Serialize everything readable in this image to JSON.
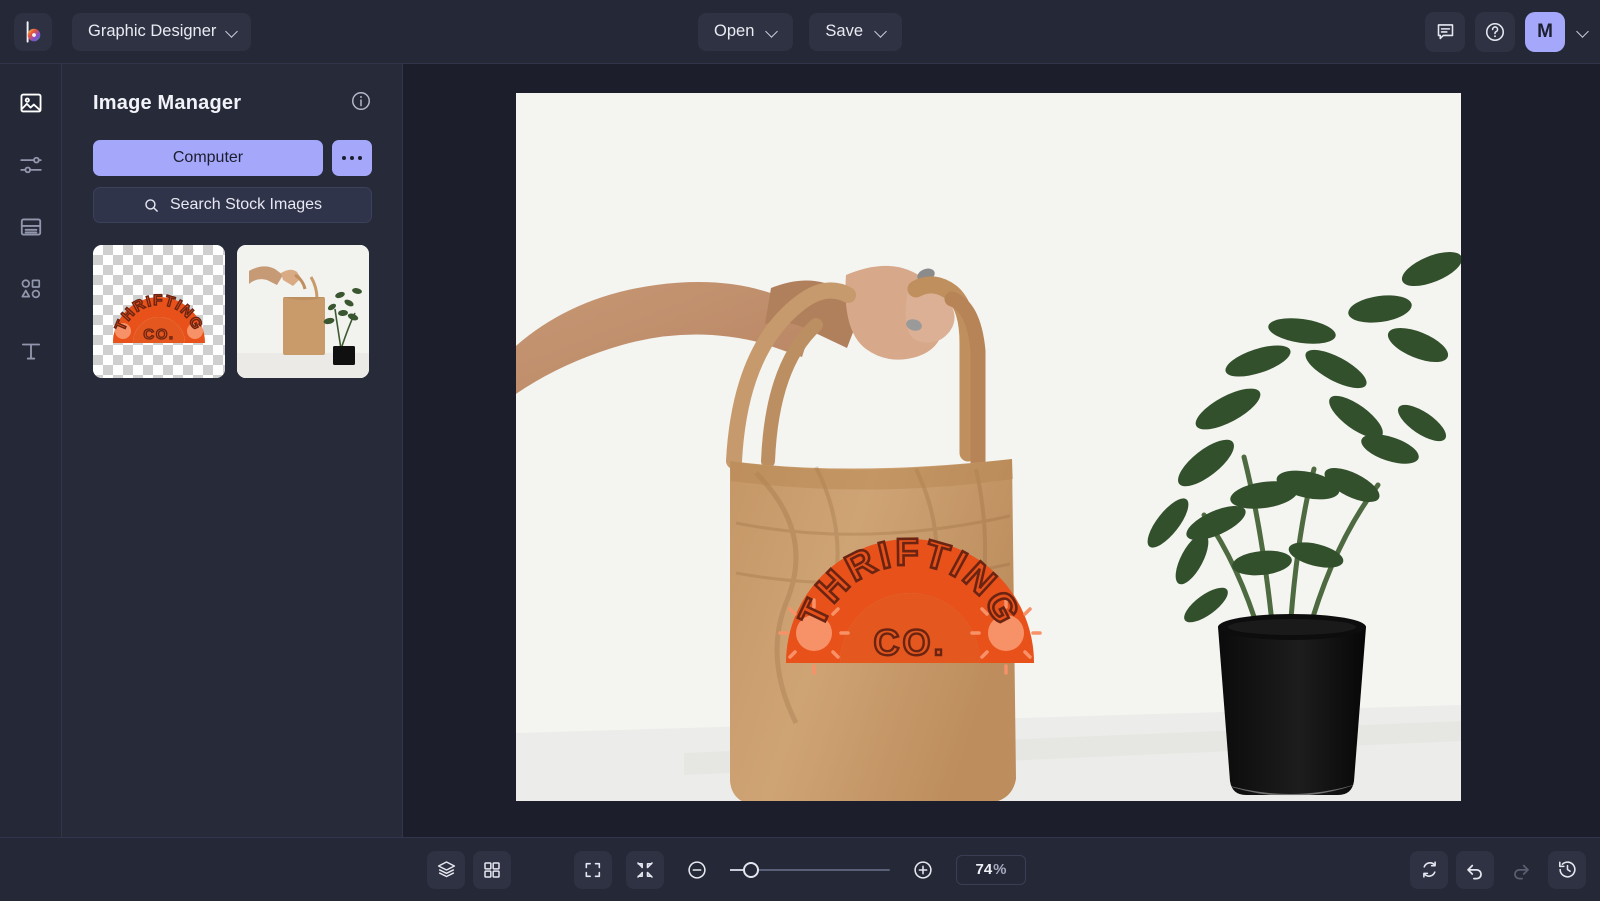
{
  "app": {
    "logo_icon": "color-wheel-logo",
    "project_title": "Graphic Designer"
  },
  "topbar": {
    "open_label": "Open",
    "save_label": "Save",
    "feedback_icon": "chat-bubble-icon",
    "help_icon": "question-circle-icon",
    "avatar_initial": "M",
    "avatar_chevron_icon": "chevron-down-icon"
  },
  "rail": {
    "items": [
      {
        "name": "image",
        "icon": "image-icon",
        "active": true
      },
      {
        "name": "adjust",
        "icon": "sliders-icon",
        "active": false
      },
      {
        "name": "layout",
        "icon": "layout-icon",
        "active": false
      },
      {
        "name": "shapes",
        "icon": "shapes-icon",
        "active": false
      },
      {
        "name": "text",
        "icon": "text-icon",
        "active": false
      }
    ]
  },
  "panel": {
    "title": "Image Manager",
    "info_icon": "info-circle-icon",
    "computer_label": "Computer",
    "more_icon": "more-options-icon",
    "search_label": "Search Stock Images",
    "search_icon": "search-icon",
    "thumbnails": [
      {
        "name": "thrifting-co-logo",
        "type": "transparent",
        "alt": "THRIFTING CO. arch logo on transparent background"
      },
      {
        "name": "tote-bag-photo",
        "type": "photo",
        "alt": "Tan tote bag held by hand next to plant"
      }
    ]
  },
  "canvas": {
    "artwork_title": "THRIFTING CO. tote bag mockup",
    "logo_top_text": "THRIFTING",
    "logo_bottom_text": "CO.",
    "logo_color": "#e8511a",
    "logo_inner_color": "#e4581f",
    "logo_outline_color": "#6b2412",
    "sun_color": "#f79268",
    "bag_color": "#c89a68",
    "background_color": "#f4f4f1"
  },
  "bottombar": {
    "layers_icon": "layers-icon",
    "grid_icon": "grid-icon",
    "fit_screen_icon": "fit-to-screen-icon",
    "shrink_icon": "shrink-to-fit-icon",
    "zoom_out_icon": "zoom-out-icon",
    "zoom_in_icon": "zoom-in-icon",
    "zoom_value": "74",
    "zoom_unit": "%",
    "slider_position_pct": 12,
    "reset_icon": "reset-icon",
    "undo_icon": "undo-icon",
    "redo_icon": "redo-icon",
    "redo_disabled": true,
    "history_icon": "history-icon"
  }
}
